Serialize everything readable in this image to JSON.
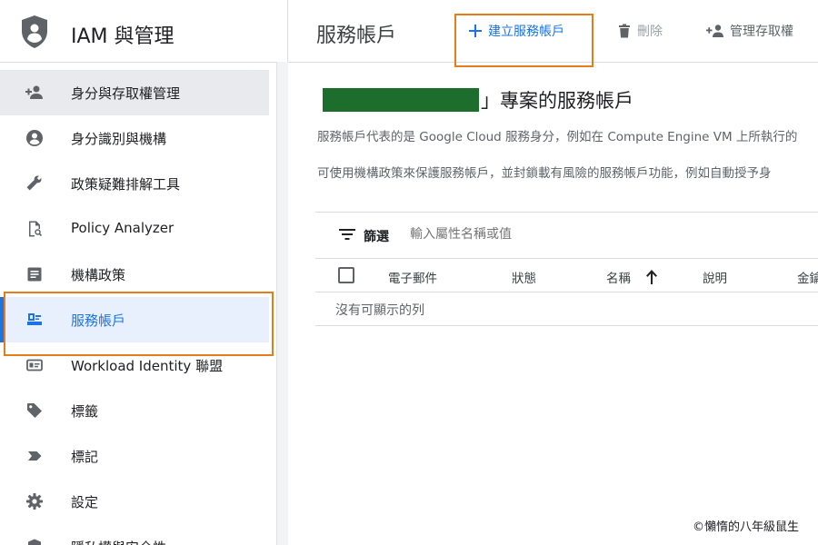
{
  "app": {
    "title": "IAM 與管理"
  },
  "sidebar": {
    "items": [
      {
        "label": "身分與存取權管理",
        "icon": "person-add-icon"
      },
      {
        "label": "身分識別與機構",
        "icon": "account-circle-icon"
      },
      {
        "label": "政策疑難排解工具",
        "icon": "wrench-icon"
      },
      {
        "label": "Policy Analyzer",
        "icon": "document-search-icon"
      },
      {
        "label": "機構政策",
        "icon": "list-document-icon"
      },
      {
        "label": "服務帳戶",
        "icon": "service-account-icon"
      },
      {
        "label": "Workload Identity 聯盟",
        "icon": "id-card-icon"
      },
      {
        "label": "標籤",
        "icon": "tag-icon"
      },
      {
        "label": "標記",
        "icon": "label-icon"
      },
      {
        "label": "設定",
        "icon": "gear-icon"
      },
      {
        "label": "隱私權與安全性",
        "icon": "shield-icon"
      }
    ],
    "active_index": 5
  },
  "toolbar": {
    "page_title": "服務帳戶",
    "create_label": "建立服務帳戶",
    "delete_label": "刪除",
    "manage_label": "管理存取權"
  },
  "main": {
    "project_heading": "」專案的服務帳戶",
    "description_1": "服務帳戶代表的是 Google Cloud 服務身分，例如在 Compute Engine VM 上所執行的",
    "description_2": "可使用機構政策來保護服務帳戶，並封鎖載有風險的服務帳戶功能，例如自動授予身"
  },
  "table": {
    "filter_label": "篩選",
    "filter_placeholder": "輸入屬性名稱或值",
    "columns": [
      "電子郵件",
      "狀態",
      "名稱",
      "說明",
      "金鑰"
    ],
    "empty_text": "沒有可顯示的列"
  },
  "watermark": "©懶惰的八年級鼠生",
  "colors": {
    "accent": "#1a73e8",
    "highlight_box": "#e37e1b",
    "redaction": "#1d6e2c"
  }
}
